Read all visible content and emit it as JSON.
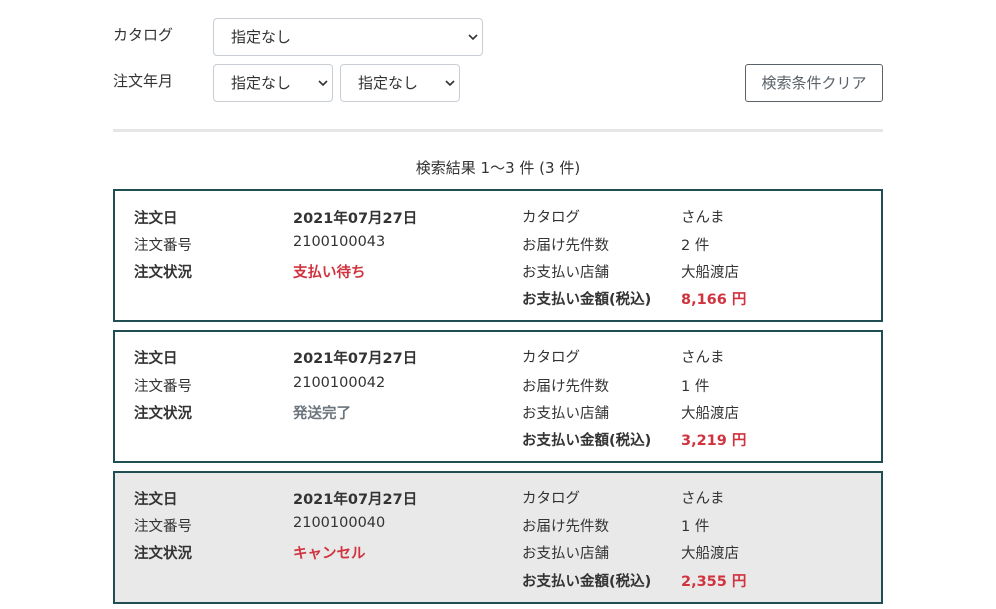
{
  "filters": {
    "catalog": {
      "label": "カタログ",
      "selected": "指定なし"
    },
    "order_month": {
      "label": "注文年月",
      "year_selected": "指定なし",
      "month_selected": "指定なし"
    },
    "clear_button_label": "検索条件クリア"
  },
  "results": {
    "summary": "検索結果 1〜3 件 (3 件)"
  },
  "field_labels": {
    "order_date": "注文日",
    "order_number": "注文番号",
    "order_status": "注文状況",
    "catalog": "カタログ",
    "delivery_count": "お届け先件数",
    "payment_store": "お支払い店舗",
    "payment_amount": "お支払い金額(税込)"
  },
  "orders": [
    {
      "order_date": "2021年07月27日",
      "order_number": "2100100043",
      "status": "支払い待ち",
      "status_color": "#d0333e",
      "catalog": "さんま",
      "delivery_count": "2 件",
      "store": "大船渡店",
      "amount": "8,166 円"
    },
    {
      "order_date": "2021年07月27日",
      "order_number": "2100100042",
      "status": "発送完了",
      "status_color": "#6c757d",
      "catalog": "さんま",
      "delivery_count": "1 件",
      "store": "大船渡店",
      "amount": "3,219 円"
    },
    {
      "order_date": "2021年07月27日",
      "order_number": "2100100040",
      "status": "キャンセル",
      "status_color": "#d0333e",
      "catalog": "さんま",
      "delivery_count": "1 件",
      "store": "大船渡店",
      "amount": "2,355 円"
    }
  ],
  "colors": {
    "card_border": "#1f4e53",
    "amount": "#d0333e",
    "cancelled_background": "#e9e9e9"
  }
}
